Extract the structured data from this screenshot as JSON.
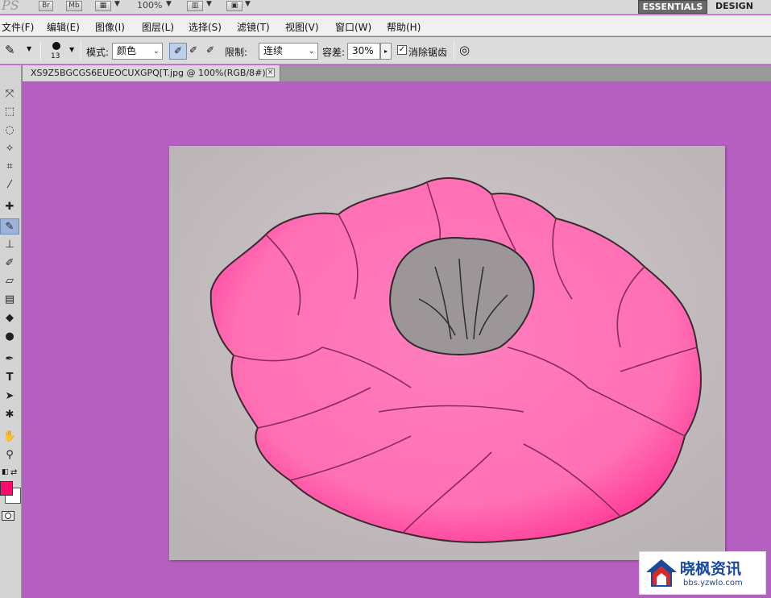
{
  "appbar": {
    "logo": "PS",
    "bridge": "Br",
    "minibridge": "Mb",
    "zoom": "100%",
    "essentials": "ESSENTIALS",
    "design": "DESIGN"
  },
  "menu": [
    {
      "label": "文件(F)"
    },
    {
      "label": "编辑(E)"
    },
    {
      "label": "图像(I)"
    },
    {
      "label": "图层(L)"
    },
    {
      "label": "选择(S)"
    },
    {
      "label": "滤镜(T)"
    },
    {
      "label": "视图(V)"
    },
    {
      "label": "窗口(W)"
    },
    {
      "label": "帮助(H)"
    }
  ],
  "options": {
    "brush_size": "13",
    "mode_label": "模式:",
    "mode_value": "颜色",
    "limit_label": "限制:",
    "limit_value": "连续",
    "tolerance_label": "容差:",
    "tolerance_value": "30%",
    "antialias_label": "消除锯齿",
    "antialias_checked": true
  },
  "document": {
    "tab_title": "XS9Z5BGCGS6EUEOCUXGPQ[T.jpg @ 100%(RGB/8#) *"
  },
  "colors": {
    "foreground": "#ff0a6e",
    "background": "#ffffff",
    "canvas_bg": "#b560c0",
    "flower_pink": "#ff6fb4"
  },
  "tools": [
    {
      "name": "move-icon"
    },
    {
      "name": "marquee-icon"
    },
    {
      "name": "lasso-icon"
    },
    {
      "name": "quick-select-icon"
    },
    {
      "name": "crop-icon"
    },
    {
      "name": "eyedropper-icon"
    },
    {
      "name": "healing-brush-icon"
    },
    {
      "name": "color-replacement-icon"
    },
    {
      "name": "clone-stamp-icon"
    },
    {
      "name": "history-brush-icon"
    },
    {
      "name": "eraser-icon"
    },
    {
      "name": "gradient-icon"
    },
    {
      "name": "blur-icon"
    },
    {
      "name": "dodge-icon"
    },
    {
      "name": "pen-icon"
    },
    {
      "name": "type-icon"
    },
    {
      "name": "path-select-icon"
    },
    {
      "name": "shape-icon"
    },
    {
      "name": "hand-icon"
    },
    {
      "name": "zoom-icon"
    }
  ],
  "watermark": {
    "title": "晓枫资讯",
    "url": "bbs.yzwlo.com"
  }
}
